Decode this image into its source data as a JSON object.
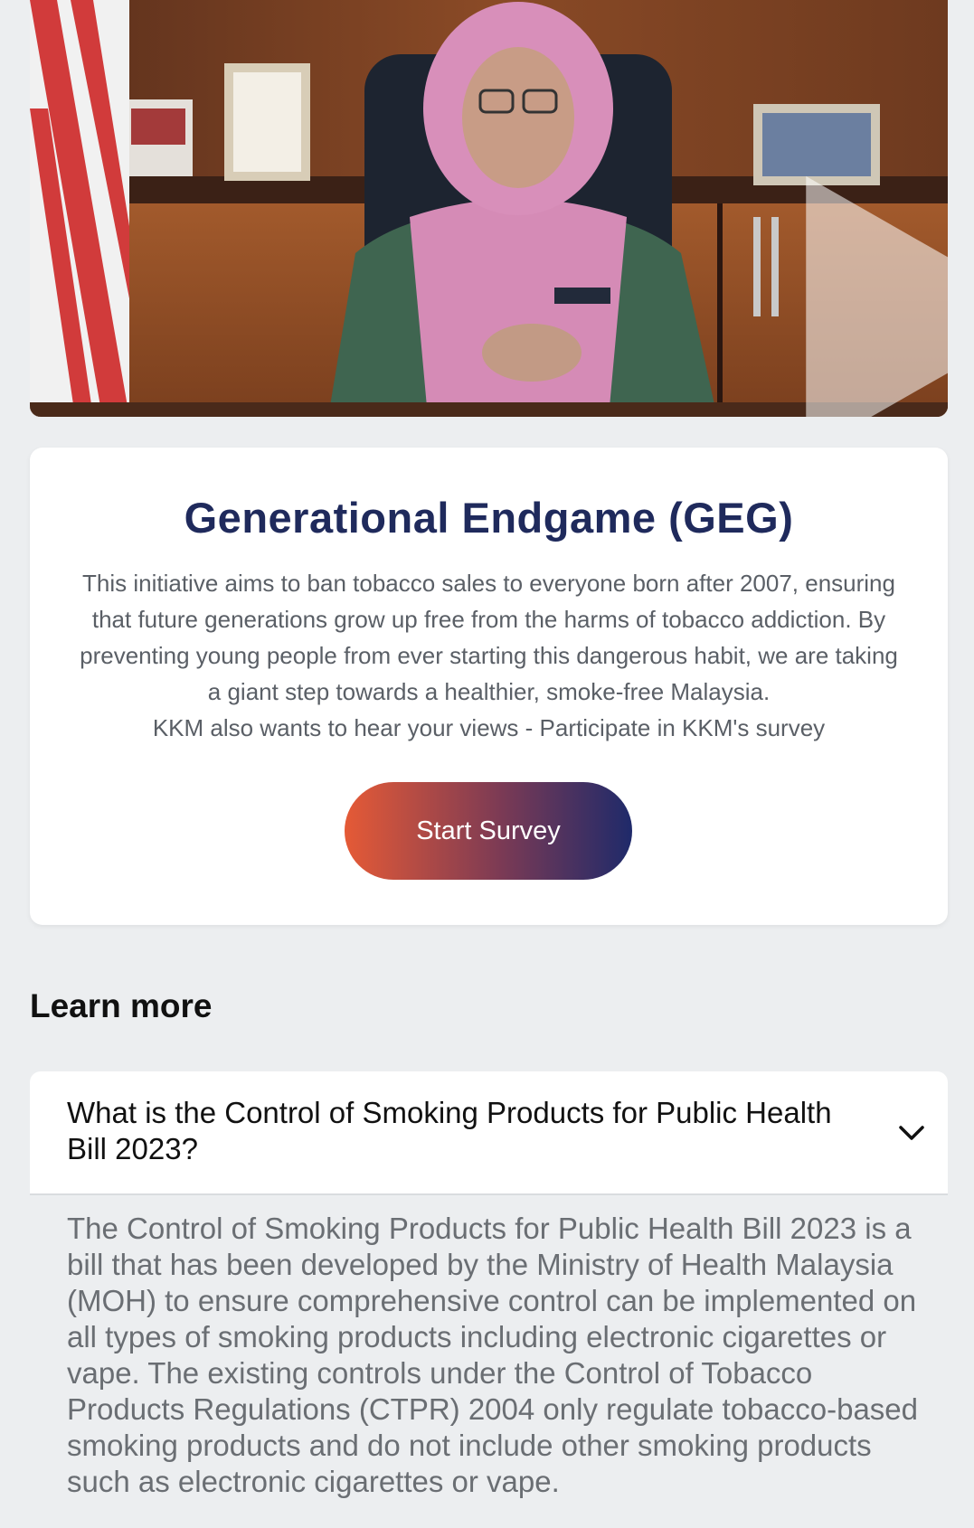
{
  "video": {
    "thumbnail_description_icon": "play-icon"
  },
  "info": {
    "title": "Generational Endgame (GEG)",
    "description": "This initiative aims to ban tobacco sales to everyone born after 2007, ensuring that future generations grow up free from the harms of tobacco addiction. By preventing young people from ever starting this dangerous habit, we are taking a giant step towards a healthier, smoke-free Malaysia.",
    "cta_text": "KKM also wants to hear your views - Participate in KKM's survey",
    "button_label": "Start Survey"
  },
  "learn_more": {
    "heading": "Learn more",
    "items": [
      {
        "question": "What is the Control of Smoking Products for Public Health Bill 2023?",
        "answer": "The Control of Smoking Products for Public Health Bill 2023 is a bill that has been developed by the Ministry of Health Malaysia (MOH) to ensure comprehensive control can be implemented on all types of smoking products including electronic cigarettes or vape. The existing controls under the Control of Tobacco Products Regulations (CTPR) 2004 only regulate tobacco-based smoking products and do not include other smoking products such as electronic cigarettes or vape.",
        "expanded": true,
        "icon": "chevron-down-icon"
      }
    ]
  },
  "colors": {
    "title": "#1f2a5c",
    "button_gradient_start": "#e55a36",
    "button_gradient_end": "#1f2a6a",
    "page_background": "#eceef0"
  }
}
